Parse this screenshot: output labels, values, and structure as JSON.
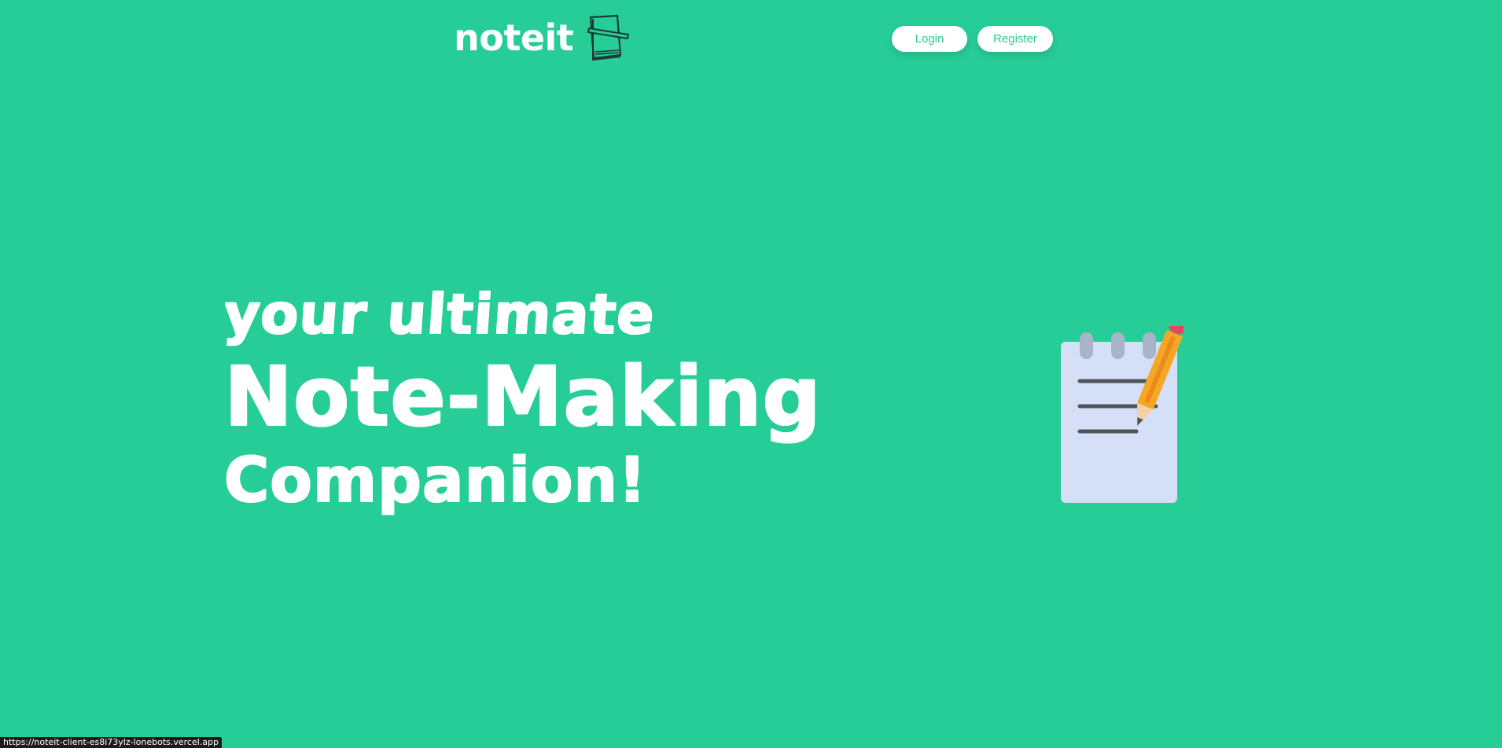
{
  "brand": {
    "name": "noteit",
    "logo_icon": "notebook-icon"
  },
  "nav": {
    "login_label": "Login",
    "register_label": "Register"
  },
  "hero": {
    "line1": "your ultimate",
    "line2": "Note-Making",
    "line3": "Companion!",
    "illustration_icon": "notepad-pencil-icon"
  },
  "status_bar": {
    "url": "https://noteit-client-es8i73ylz-lonebots.vercel.app"
  },
  "colors": {
    "background": "#27cd97",
    "text": "#ffffff",
    "button_text": "#27cd97",
    "notepad_paper": "#d5dff8",
    "pencil_body": "#f5a623",
    "pencil_eraser": "#e8445a"
  }
}
